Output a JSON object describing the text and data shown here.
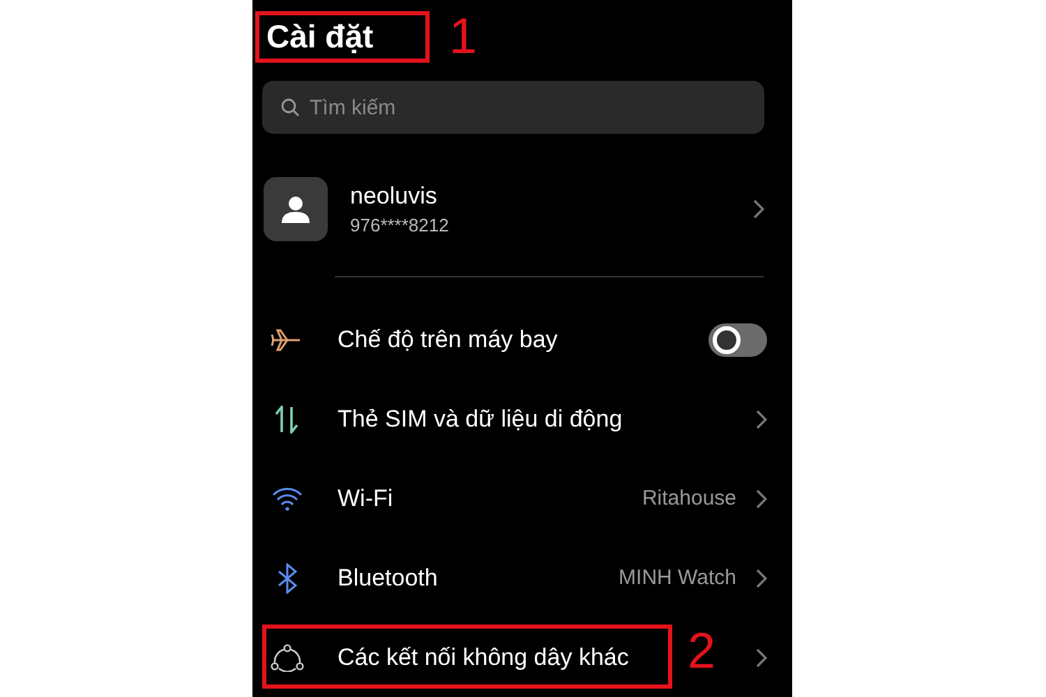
{
  "title": {
    "text": "Cài đặt",
    "callout": "1"
  },
  "search": {
    "placeholder": "Tìm kiếm"
  },
  "account": {
    "name": "neoluvis",
    "phone": "976****8212"
  },
  "items": [
    {
      "kind": "toggle",
      "label": "Chế độ trên máy bay",
      "on": false
    },
    {
      "kind": "link",
      "label": "Thẻ SIM và dữ liệu di động"
    },
    {
      "kind": "link",
      "label": "Wi-Fi",
      "value": "Ritahouse"
    },
    {
      "kind": "link",
      "label": "Bluetooth",
      "value": "MINH Watch"
    },
    {
      "kind": "link",
      "label": "Các kết nối không dây khác",
      "callout": "2"
    }
  ]
}
